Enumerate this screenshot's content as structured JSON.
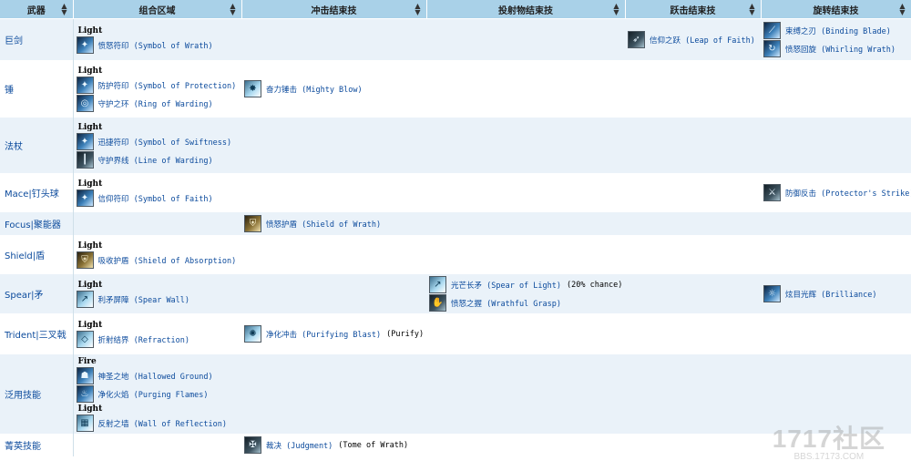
{
  "headers": [
    {
      "label": "武器"
    },
    {
      "label": "组合区域"
    },
    {
      "label": "冲击结束技"
    },
    {
      "label": "投射物结束技"
    },
    {
      "label": "跃击结束技"
    },
    {
      "label": "旋转结束技"
    }
  ],
  "rows": [
    {
      "weapon": "巨剑",
      "combo": [
        {
          "group": "Light",
          "skills": [
            {
              "name": "愤怒符印 (Symbol of Wrath)",
              "icon": "symbol-icon"
            }
          ]
        }
      ],
      "blast": [],
      "projectile": [],
      "leap": [
        {
          "name": "信仰之跃 (Leap of Faith)",
          "icon": "leap-icon"
        }
      ],
      "whirl": [
        {
          "name": "束缚之刃 (Binding Blade)",
          "icon": "blade-icon"
        },
        {
          "name": "愤怒回旋 (Whirling Wrath)",
          "icon": "whirl-icon"
        }
      ]
    },
    {
      "weapon": "锤",
      "combo": [
        {
          "group": "Light",
          "skills": [
            {
              "name": "防护符印 (Symbol of Protection)",
              "icon": "symbol-icon"
            },
            {
              "name": "守护之环 (Ring of Warding)",
              "icon": "ring-icon"
            }
          ]
        }
      ],
      "blast": [
        {
          "name": "奋力锤击 (Mighty Blow)",
          "icon": "hammer-icon"
        }
      ],
      "projectile": [],
      "leap": [],
      "whirl": []
    },
    {
      "weapon": "法杖",
      "combo": [
        {
          "group": "Light",
          "skills": [
            {
              "name": "迅捷符印 (Symbol of Swiftness)",
              "icon": "symbol-icon"
            },
            {
              "name": "守护界线 (Line of Warding)",
              "icon": "line-icon"
            }
          ]
        }
      ],
      "blast": [],
      "projectile": [],
      "leap": [],
      "whirl": []
    },
    {
      "weapon": "Mace|钉头球",
      "combo": [
        {
          "group": "Light",
          "skills": [
            {
              "name": "信仰符印 (Symbol of Faith)",
              "icon": "symbol-icon"
            }
          ]
        }
      ],
      "blast": [],
      "projectile": [],
      "leap": [],
      "whirl": [
        {
          "name": "防御反击 (Protector's Strike)",
          "icon": "strike-icon"
        }
      ]
    },
    {
      "weapon": "Focus|聚能器",
      "combo": [],
      "blast": [
        {
          "name": "愤怒护盾 (Shield of Wrath)",
          "icon": "shield-icon"
        }
      ],
      "projectile": [],
      "leap": [],
      "whirl": []
    },
    {
      "weapon": "Shield|盾",
      "combo": [
        {
          "group": "Light",
          "skills": [
            {
              "name": "吸收护盾 (Shield of Absorption)",
              "icon": "shield-icon"
            }
          ]
        }
      ],
      "blast": [],
      "projectile": [],
      "leap": [],
      "whirl": []
    },
    {
      "weapon": "Spear|矛",
      "combo": [
        {
          "group": "Light",
          "skills": [
            {
              "name": "利矛屏障 (Spear Wall)",
              "icon": "spear-icon"
            }
          ]
        }
      ],
      "blast": [],
      "projectile": [
        {
          "name": "光芒长矛 (Spear of Light)",
          "icon": "spear-icon",
          "extra": "(20% chance)"
        },
        {
          "name": "愤怒之握 (Wrathful Grasp)",
          "icon": "grasp-icon"
        }
      ],
      "leap": [],
      "whirl": [
        {
          "name": "炫目光辉 (Brilliance)",
          "icon": "brilliance-icon"
        }
      ]
    },
    {
      "weapon": "Trident|三叉戟",
      "combo": [
        {
          "group": "Light",
          "skills": [
            {
              "name": "折射结界 (Refraction)",
              "icon": "refraction-icon"
            }
          ]
        }
      ],
      "blast": [
        {
          "name": "净化冲击 (Purifying Blast)",
          "icon": "blast-icon",
          "extra": "(Purify)"
        }
      ],
      "projectile": [],
      "leap": [],
      "whirl": []
    },
    {
      "weapon": "泛用技能",
      "combo": [
        {
          "group": "Fire",
          "skills": [
            {
              "name": "神圣之地 (Hallowed Ground)",
              "icon": "ground-icon"
            },
            {
              "name": "净化火焰 (Purging Flames)",
              "icon": "flame-icon"
            }
          ]
        },
        {
          "group": "Light",
          "skills": [
            {
              "name": "反射之墙 (Wall of Reflection)",
              "icon": "wall-icon"
            }
          ]
        }
      ],
      "blast": [],
      "projectile": [],
      "leap": [],
      "whirl": []
    },
    {
      "weapon": "菁英技能",
      "combo": [],
      "blast": [
        {
          "name": "裁决 (Judgment)",
          "icon": "judgment-icon",
          "extra": "(Tome of Wrath)"
        }
      ],
      "projectile": [],
      "leap": [],
      "whirl": []
    }
  ],
  "watermark": {
    "logo": "1717社区",
    "url": "BBS.17173.COM"
  }
}
